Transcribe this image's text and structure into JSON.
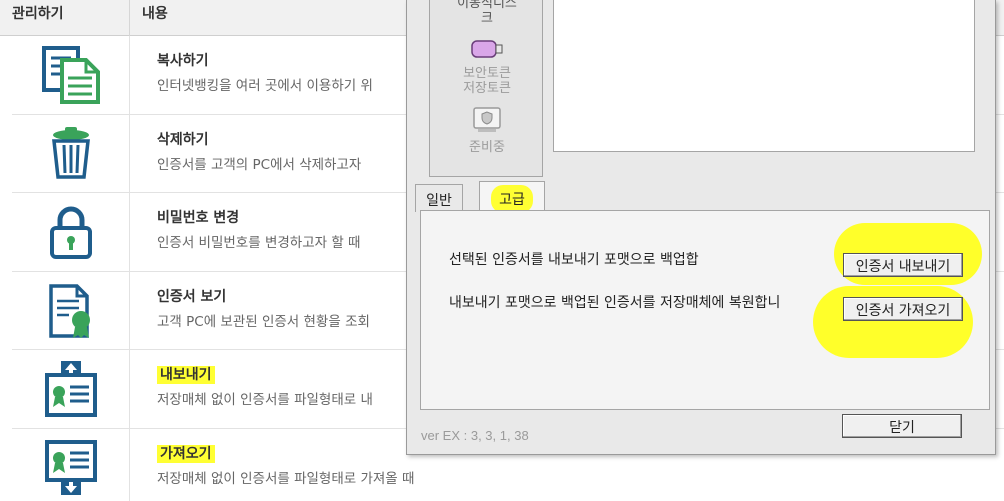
{
  "table": {
    "header_manage": "관리하기",
    "header_content": "내용",
    "rows": [
      {
        "icon": "copy-document-icon",
        "title": "복사하기",
        "desc": "인터넷뱅킹을 여러 곳에서 이용하기 위"
      },
      {
        "icon": "trash-bin-icon",
        "title": "삭제하기",
        "desc": "인증서를 고객의 PC에서 삭제하고자"
      },
      {
        "icon": "padlock-icon",
        "title": "비밀번호 변경",
        "desc": "인증서 비밀번호를 변경하고자 할 때"
      },
      {
        "icon": "certificate-view-icon",
        "title": "인증서 보기",
        "desc": "고객 PC에 보관된 인증서 현황을 조회"
      },
      {
        "icon": "certificate-export-icon",
        "title": "내보내기",
        "desc": "저장매체 없이 인증서를 파일형태로 내"
      },
      {
        "icon": "certificate-import-icon",
        "title": "가져오기",
        "desc": "저장매체 없이 인증서를 파일형태로 가져올 때"
      }
    ]
  },
  "dialog": {
    "media": {
      "item1_line1": "이동식디스",
      "item1_line2": "크",
      "item2_line1": "보안토큰",
      "item2_line2": "저장토큰",
      "item3_line1": "준비중"
    },
    "tabs": {
      "general": "일반",
      "advanced": "고급"
    },
    "panel": {
      "export_text": "선택된 인증서를 내보내기 포맷으로 백업합",
      "export_button": "인증서 내보내기",
      "import_text": "내보내기 포맷으로 백업된 인증서를 저장매체에 복원합니",
      "import_button": "인증서 가져오기"
    },
    "close_button": "닫기",
    "version": "ver EX : 3, 3, 1, 38"
  },
  "colors": {
    "icon_blue": "#1f5d8c",
    "icon_green": "#3aa35a",
    "highlight": "#ffff33"
  }
}
